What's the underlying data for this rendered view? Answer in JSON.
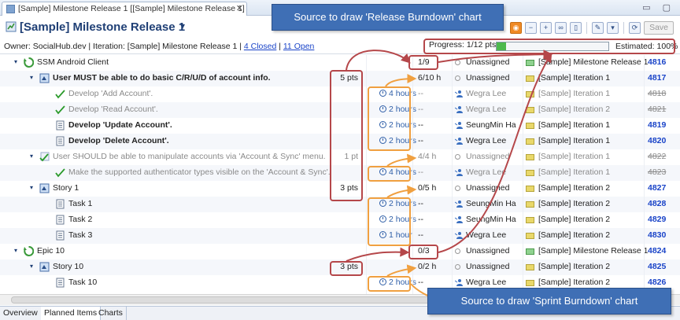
{
  "window": {
    "tab_title": "[Sample] Milestone Release 1 [[Sample] Milestone Release 1]",
    "tab_close": "✕",
    "win_buttons": "▭ ▢",
    "page_title": "[Sample] Milestone Release 1",
    "title_caret": "▾"
  },
  "toolbar": {
    "buttons": [
      "feed",
      "collapse",
      "expand",
      "link",
      "sidebar",
      "edit",
      "menu",
      "sync"
    ],
    "save_label": "Save"
  },
  "info": {
    "owner_text": "Owner: SocialHub.dev | Iteration: [Sample] Milestone Release 1 | ",
    "closed_link": "4 Closed",
    "separator": " | ",
    "open_link": "11 Open",
    "progress_label": "Progress: 1/12 pts",
    "progress_fraction": 0.0833,
    "estimated_label": "Estimated: 100%"
  },
  "rows": [
    {
      "name": "SSM Android Client",
      "level": 0,
      "type": "epic",
      "size": "",
      "estimate": "",
      "progress": "1/9",
      "owner": "Unassigned",
      "plan": "[Sample] Milestone Release 1",
      "plan_kind": "green",
      "id": "4816",
      "style": "normal",
      "strike": false,
      "twisty": "▾"
    },
    {
      "name": "User MUST be able to do basic C/R/U/D of account info.",
      "level": 1,
      "type": "story",
      "size": "5 pts",
      "estimate": "",
      "progress": "6/10 h",
      "owner": "Unassigned",
      "plan": "[Sample] Iteration 1",
      "plan_kind": "yellow",
      "id": "4817",
      "style": "bold",
      "strike": false,
      "twisty": "▾"
    },
    {
      "name": "Develop 'Add Account'.",
      "level": 2,
      "type": "task-done",
      "size": "",
      "estimate": "4 hours",
      "progress": "--",
      "owner": "Wegra Lee",
      "plan": "[Sample] Iteration 1",
      "plan_kind": "yellow",
      "id": "4818",
      "style": "grey",
      "strike": true,
      "twisty": ""
    },
    {
      "name": "Develop 'Read Account'.",
      "level": 2,
      "type": "task-done",
      "size": "",
      "estimate": "2 hours",
      "progress": "--",
      "owner": "Wegra Lee",
      "plan": "[Sample] Iteration 2",
      "plan_kind": "yellow",
      "id": "4821",
      "style": "grey",
      "strike": true,
      "twisty": ""
    },
    {
      "name": "Develop 'Update Account'.",
      "level": 2,
      "type": "task",
      "size": "",
      "estimate": "2 hours",
      "progress": "--",
      "owner": "SeungMin Ha",
      "plan": "[Sample] Iteration 1",
      "plan_kind": "yellow",
      "id": "4819",
      "style": "bold",
      "strike": false,
      "twisty": ""
    },
    {
      "name": "Develop 'Delete Account'.",
      "level": 2,
      "type": "task",
      "size": "",
      "estimate": "2 hours",
      "progress": "--",
      "owner": "Wegra Lee",
      "plan": "[Sample] Iteration 1",
      "plan_kind": "yellow",
      "id": "4820",
      "style": "bold",
      "strike": false,
      "twisty": ""
    },
    {
      "name": "User SHOULD be able to manipulate accounts via 'Account & Sync' menu.",
      "level": 1,
      "type": "story-done",
      "size": "1 pt",
      "estimate": "",
      "progress": "4/4 h",
      "owner": "Unassigned",
      "plan": "[Sample] Iteration 1",
      "plan_kind": "yellow",
      "id": "4822",
      "style": "grey",
      "strike": true,
      "twisty": "▾"
    },
    {
      "name": "Make the supported authenticator types visible on the 'Account & Sync'.",
      "level": 2,
      "type": "task-done",
      "size": "",
      "estimate": "4 hours",
      "progress": "--",
      "owner": "Wegra Lee",
      "plan": "[Sample] Iteration 1",
      "plan_kind": "yellow",
      "id": "4823",
      "style": "grey",
      "strike": true,
      "twisty": ""
    },
    {
      "name": "Story 1",
      "level": 1,
      "type": "story",
      "size": "3 pts",
      "estimate": "",
      "progress": "0/5 h",
      "owner": "Unassigned",
      "plan": "[Sample] Iteration 2",
      "plan_kind": "yellow",
      "id": "4827",
      "style": "normal",
      "strike": false,
      "twisty": "▾"
    },
    {
      "name": "Task 1",
      "level": 2,
      "type": "task",
      "size": "",
      "estimate": "2 hours",
      "progress": "--",
      "owner": "SeungMin Ha",
      "plan": "[Sample] Iteration 2",
      "plan_kind": "yellow",
      "id": "4828",
      "style": "normal",
      "strike": false,
      "twisty": ""
    },
    {
      "name": "Task 2",
      "level": 2,
      "type": "task",
      "size": "",
      "estimate": "2 hours",
      "progress": "--",
      "owner": "SeungMin Ha",
      "plan": "[Sample] Iteration 2",
      "plan_kind": "yellow",
      "id": "4829",
      "style": "normal",
      "strike": false,
      "twisty": ""
    },
    {
      "name": "Task 3",
      "level": 2,
      "type": "task",
      "size": "",
      "estimate": "1 hour",
      "progress": "--",
      "owner": "Wegra Lee",
      "plan": "[Sample] Iteration 2",
      "plan_kind": "yellow",
      "id": "4830",
      "style": "normal",
      "strike": false,
      "twisty": ""
    },
    {
      "name": "Epic 10",
      "level": 0,
      "type": "epic",
      "size": "",
      "estimate": "",
      "progress": "0/3",
      "owner": "Unassigned",
      "plan": "[Sample] Milestone Release 1",
      "plan_kind": "green",
      "id": "4824",
      "style": "normal",
      "strike": false,
      "twisty": "▾"
    },
    {
      "name": "Story 10",
      "level": 1,
      "type": "story",
      "size": "3 pts",
      "estimate": "",
      "progress": "0/2 h",
      "owner": "Unassigned",
      "plan": "[Sample] Iteration 2",
      "plan_kind": "yellow",
      "id": "4825",
      "style": "normal",
      "strike": false,
      "twisty": "▾"
    },
    {
      "name": "Task 10",
      "level": 2,
      "type": "task",
      "size": "",
      "estimate": "2 hours",
      "progress": "--",
      "owner": "Wegra Lee",
      "plan": "[Sample] Iteration 2",
      "plan_kind": "yellow",
      "id": "4826",
      "style": "normal",
      "strike": false,
      "twisty": ""
    }
  ],
  "bottom_tabs": [
    "Overview",
    "Planned Items",
    "Charts"
  ],
  "annotations": {
    "release": "Source to draw 'Release Burndown' chart",
    "sprint": "Source to draw 'Sprint Burndown' chart"
  },
  "colors": {
    "title_blue": "#1f3f75",
    "link_blue": "#1a44c8",
    "progress_green": "#4db94d",
    "annotation_bg": "#3f6fb5",
    "highlight_red": "#b5474a",
    "highlight_orange": "#f0a040"
  }
}
